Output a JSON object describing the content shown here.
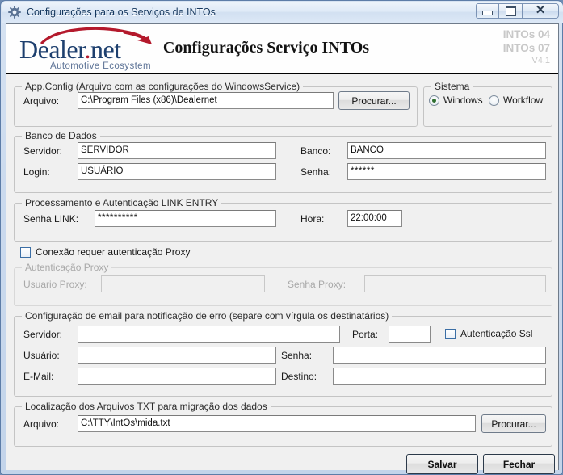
{
  "window": {
    "title": "Configurações para os Serviços de INTOs",
    "icon": "gear-icon",
    "buttons": {
      "minimize": "minimize-icon",
      "maximize": "maximize-icon",
      "close": "close-icon"
    }
  },
  "header": {
    "logo_word": "Dealer",
    "logo_dot": ".",
    "logo_net": "net",
    "logo_tagline": "Automotive Ecosystem",
    "title": "Configurações Serviço INTOs",
    "version_line1": "INTOs 04",
    "version_line2": "INTOs 07",
    "version_line3": "V4.1"
  },
  "appconfig": {
    "legend": "App.Config (Arquivo com as configurações do WindowsService)",
    "file_label": "Arquivo:",
    "file_value": "C:\\Program Files (x86)\\Dealernet",
    "browse_label": "Procurar..."
  },
  "sistema": {
    "legend": "Sistema",
    "options": [
      {
        "label": "Windows",
        "selected": true
      },
      {
        "label": "Workflow",
        "selected": false
      }
    ]
  },
  "database": {
    "legend": "Banco de Dados",
    "server_label": "Servidor:",
    "server_value": "SERVIDOR",
    "bank_label": "Banco:",
    "bank_value": "BANCO",
    "login_label": "Login:",
    "login_value": "USUÁRIO",
    "password_label": "Senha:",
    "password_value": "******"
  },
  "linkentry": {
    "legend": "Processamento e Autenticação LINK ENTRY",
    "password_label": "Senha LINK:",
    "password_value": "**********",
    "hour_label": "Hora:",
    "hour_value": "22:00:00"
  },
  "proxy_checkbox": {
    "label": "Conexão requer autenticação Proxy",
    "checked": false
  },
  "proxy": {
    "legend": "Autenticação Proxy",
    "user_label": "Usuario Proxy:",
    "user_value": "",
    "password_label": "Senha Proxy:",
    "password_value": "",
    "disabled": true
  },
  "email": {
    "legend": "Configuração de email para notificação de erro (separe com vírgula os destinatários)",
    "server_label": "Servidor:",
    "server_value": "",
    "port_label": "Porta:",
    "port_value": "",
    "ssl_label": "Autenticação Ssl",
    "ssl_checked": false,
    "user_label": "Usuário:",
    "user_value": "",
    "password_label": "Senha:",
    "password_value": "",
    "mail_label": "E-Mail:",
    "mail_value": "",
    "dest_label": "Destino:",
    "dest_value": ""
  },
  "txtfiles": {
    "legend": "Localização dos Arquivos TXT para migração dos dados",
    "file_label": "Arquivo:",
    "file_value": "C:\\TTY\\IntOs\\mida.txt",
    "browse_label": "Procurar..."
  },
  "footer": {
    "save_prefix": "S",
    "save_rest": "alvar",
    "close_prefix": "F",
    "close_rest": "echar"
  },
  "colors": {
    "logo_blue": "#1d3f6e",
    "logo_red": "#b4192c",
    "window_blue": "#5d7da8",
    "face": "#f0f0f0"
  }
}
